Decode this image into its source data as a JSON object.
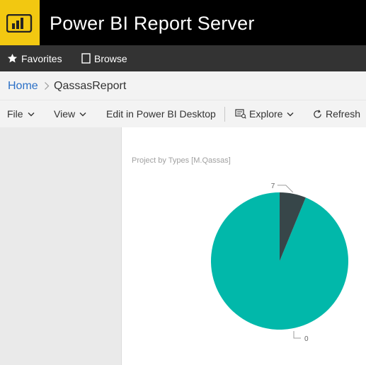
{
  "app": {
    "title": "Power BI Report Server",
    "logo_icon": "power-bi-logo-icon",
    "brand_color": "#f2c811"
  },
  "nav": {
    "favorites": {
      "label": "Favorites",
      "icon": "star-icon"
    },
    "browse": {
      "label": "Browse",
      "icon": "browse-icon"
    }
  },
  "breadcrumb": {
    "home": "Home",
    "current": "QassasReport"
  },
  "toolbar": {
    "file": "File",
    "view": "View",
    "edit": "Edit in Power BI Desktop",
    "explore": "Explore",
    "refresh": "Refresh"
  },
  "report": {
    "visual_title": "Project by Types [M.Qassas]"
  },
  "chart_data": {
    "type": "pie",
    "title": "Project by Types [M.Qassas]",
    "slices": [
      {
        "label": "0",
        "value": 93.8,
        "color": "#01b8aa"
      },
      {
        "label": "7",
        "value": 6.2,
        "color": "#374649"
      }
    ],
    "data_labels": [
      "7",
      "0"
    ]
  }
}
